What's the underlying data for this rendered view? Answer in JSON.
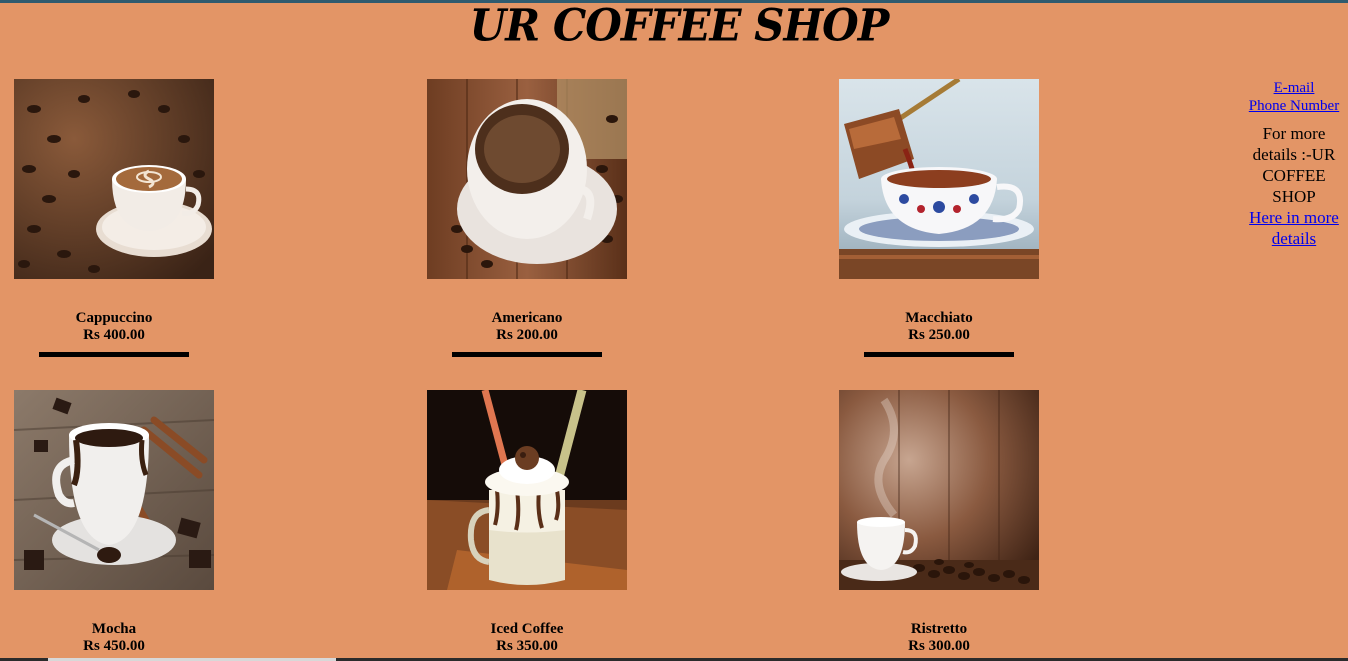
{
  "header": {
    "title": "UR COFFEE SHOP"
  },
  "products": [
    {
      "name": "Cappuccino",
      "price": "Rs 400.00",
      "image": "cappuccino-image"
    },
    {
      "name": "Americano",
      "price": "Rs 200.00",
      "image": "americano-image"
    },
    {
      "name": "Macchiato",
      "price": "Rs 250.00",
      "image": "macchiato-image"
    },
    {
      "name": "Mocha",
      "price": "Rs 450.00",
      "image": "mocha-image"
    },
    {
      "name": "Iced Coffee",
      "price": "Rs 350.00",
      "image": "iced-coffee-image"
    },
    {
      "name": "Ristretto",
      "price": "Rs 300.00",
      "image": "ristretto-image"
    }
  ],
  "sidebar": {
    "email_label": "E-mail",
    "phone_label": "Phone Number",
    "details_text": "For more details :-UR COFFEE SHOP",
    "more_link_label": "Here in more details"
  },
  "colors": {
    "background": "#e39566",
    "top_border": "#2f5b6f",
    "link": "#0000ee"
  }
}
